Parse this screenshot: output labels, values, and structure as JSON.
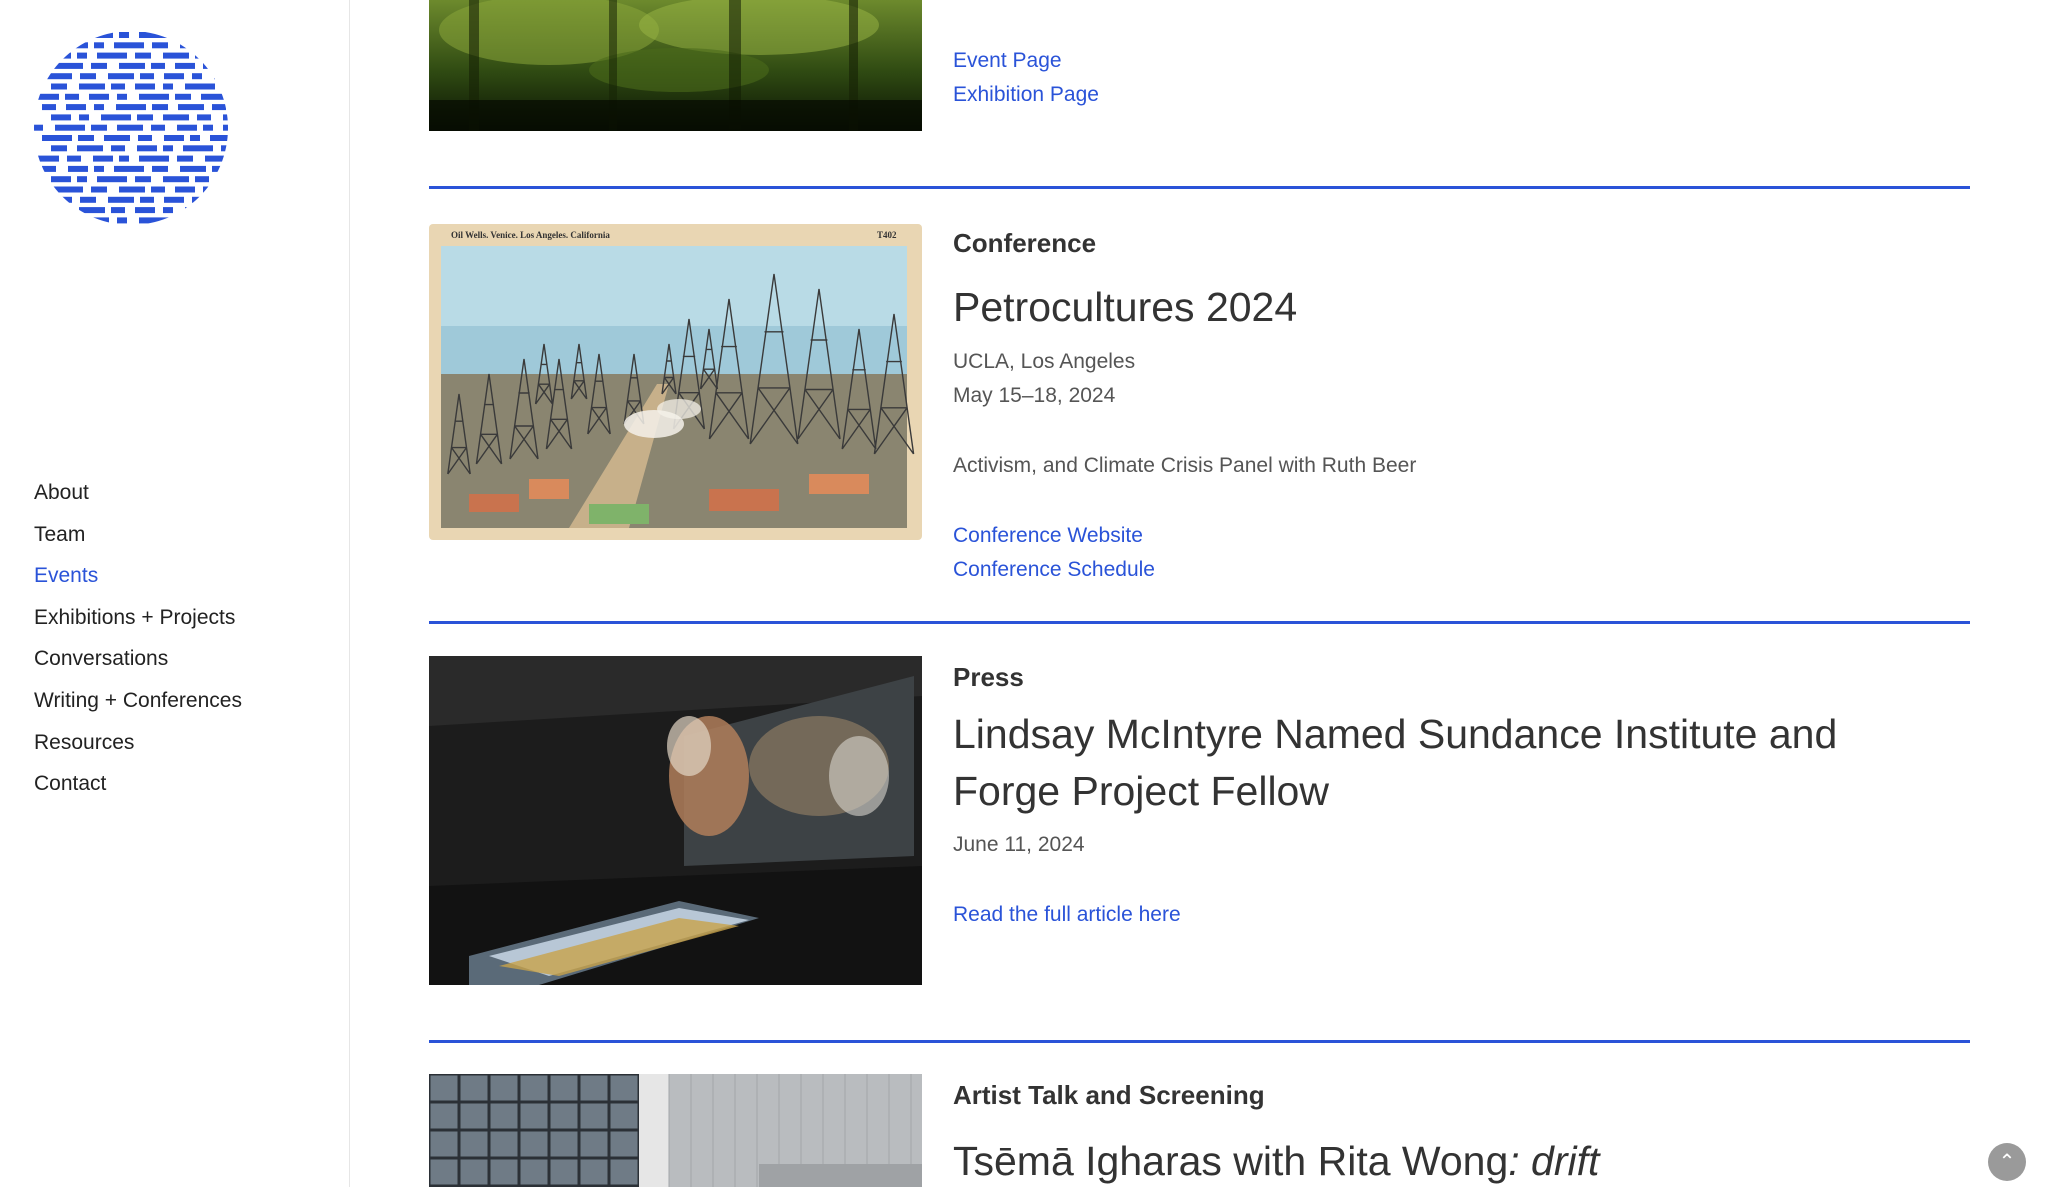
{
  "nav": {
    "items": [
      {
        "label": "About"
      },
      {
        "label": "Team"
      },
      {
        "label": "Events"
      },
      {
        "label": "Exhibitions + Projects"
      },
      {
        "label": "Conversations"
      },
      {
        "label": "Writing + Conferences"
      },
      {
        "label": "Resources"
      },
      {
        "label": "Contact"
      }
    ],
    "active": "Events"
  },
  "items": [
    {
      "links": [
        "Event Page",
        "Exhibition Page"
      ]
    },
    {
      "category": "Conference",
      "title": "Petrocultures 2024",
      "location": "UCLA, Los Angeles",
      "date": "May 15–18, 2024",
      "description": "Activism, and Climate Crisis Panel with Ruth Beer",
      "links": [
        "Conference Website",
        "Conference Schedule"
      ],
      "postcard": {
        "caption": "Oil Wells. Venice. Los Angeles. California",
        "code": "T402"
      }
    },
    {
      "category": "Press",
      "title_line1": "Lindsay McIntyre Named Sundance Institute and",
      "title_line2": "Forge Project Fellow",
      "date": "June 11, 2024",
      "links": [
        "Read the full article here"
      ]
    },
    {
      "category": "Artist Talk and Screening",
      "title_main": "Tsēmā Igharas with Rita Wong",
      "title_italic": ": drift"
    }
  ],
  "icons": {
    "scroll_top": "chevron-up-icon"
  },
  "colors": {
    "accent": "#2a53d8",
    "text": "#333333",
    "divider": "#2a53d8"
  }
}
